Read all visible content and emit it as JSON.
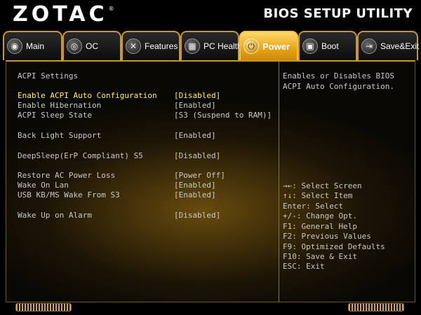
{
  "brand": {
    "logo": "ZOTAC",
    "trademark": "®"
  },
  "header": {
    "title": "BIOS SETUP UTILITY"
  },
  "tabs": [
    {
      "label": "Main",
      "icon": "disc-icon",
      "glyph": "◉",
      "active": false
    },
    {
      "label": "OC",
      "icon": "gauge-icon",
      "glyph": "◎",
      "active": false
    },
    {
      "label": "Features",
      "icon": "tools-icon",
      "glyph": "✕",
      "active": false
    },
    {
      "label": "PC Health",
      "icon": "chip-icon",
      "glyph": "▦",
      "active": false
    },
    {
      "label": "Power",
      "icon": "power-icon",
      "glyph": "⏻",
      "active": true
    },
    {
      "label": "Boot",
      "icon": "lock-icon",
      "glyph": "▣",
      "active": false
    },
    {
      "label": "Save&Exit",
      "icon": "exit-icon",
      "glyph": "⇥",
      "active": false
    }
  ],
  "settings": {
    "section_title": "ACPI Settings",
    "items": [
      {
        "label": "Enable ACPI Auto Configuration",
        "value": "[Disabled]",
        "selected": true
      },
      {
        "label": "Enable Hibernation",
        "value": "[Enabled]",
        "selected": false
      },
      {
        "label": "ACPI Sleep State",
        "value": "[S3 (Suspend to RAM)]",
        "selected": false
      },
      {
        "label": "Back Light Support",
        "value": "[Enabled]",
        "selected": false
      },
      {
        "label": "DeepSleep(ErP Compliant) S5",
        "value": "[Disabled]",
        "selected": false
      },
      {
        "label": "Restore AC Power Loss",
        "value": "[Power Off]",
        "selected": false
      },
      {
        "label": "Wake On Lan",
        "value": "[Enabled]",
        "selected": false
      },
      {
        "label": "USB KB/MS Wake From S3",
        "value": "[Enabled]",
        "selected": false
      },
      {
        "label": "Wake Up on Alarm",
        "value": "[Disabled]",
        "selected": false
      }
    ]
  },
  "help": {
    "description": "Enables or Disables BIOS ACPI Auto Configuration.",
    "keys": [
      "→←: Select Screen",
      "↑↓: Select Item",
      "Enter: Select",
      "+/-: Change Opt.",
      "F1: General Help",
      "F2: Previous Values",
      "F9: Optimized Defaults",
      "F10: Save & Exit",
      "ESC: Exit"
    ]
  },
  "colors": {
    "accent": "#e8a315",
    "selected_text": "#fff25c",
    "body_text": "#c9c9c9",
    "tab_border": "#c9982c"
  }
}
